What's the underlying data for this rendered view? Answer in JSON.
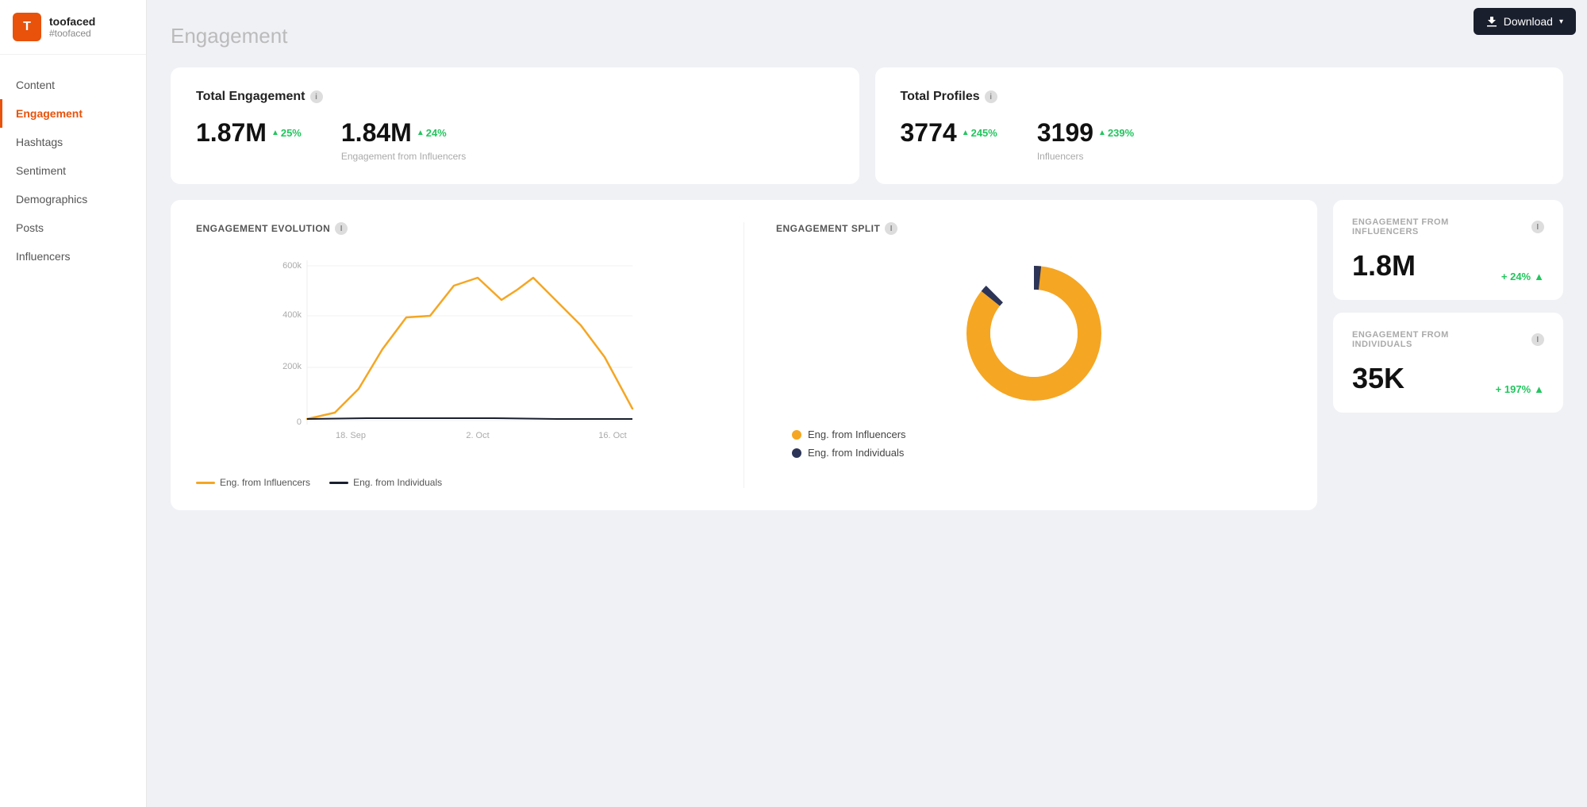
{
  "brand": {
    "avatar_letter": "T",
    "name": "toofaced",
    "handle": "#toofaced"
  },
  "nav": {
    "items": [
      {
        "label": "Content",
        "active": false,
        "id": "content"
      },
      {
        "label": "Engagement",
        "active": true,
        "id": "engagement"
      },
      {
        "label": "Hashtags",
        "active": false,
        "id": "hashtags"
      },
      {
        "label": "Sentiment",
        "active": false,
        "id": "sentiment"
      },
      {
        "label": "Demographics",
        "active": false,
        "id": "demographics"
      },
      {
        "label": "Posts",
        "active": false,
        "id": "posts"
      },
      {
        "label": "Influencers",
        "active": false,
        "id": "influencers"
      }
    ]
  },
  "page": {
    "title": "Engagement"
  },
  "download_button": "Download",
  "stats": {
    "total_engagement": {
      "title": "Total Engagement",
      "main_value": "1.87M",
      "main_change": "25%",
      "secondary_value": "1.84M",
      "secondary_change": "24%",
      "secondary_label": "Engagement from Influencers"
    },
    "total_profiles": {
      "title": "Total Profiles",
      "main_value": "3774",
      "main_change": "245%",
      "secondary_value": "3199",
      "secondary_change": "239%",
      "secondary_label": "Influencers"
    }
  },
  "engagement_evolution": {
    "title": "ENGAGEMENT EVOLUTION",
    "y_labels": [
      "600k",
      "400k",
      "200k",
      "0"
    ],
    "x_labels": [
      "18. Sep",
      "2. Oct",
      "16. Oct"
    ],
    "legend": [
      {
        "label": "Eng. from Influencers",
        "color": "#f5a623"
      },
      {
        "label": "Eng. from Individuals",
        "color": "#1a1f2e"
      }
    ]
  },
  "engagement_split": {
    "title": "ENGAGEMENT SPLIT",
    "legend": [
      {
        "label": "Eng. from Influencers",
        "color": "#f5a623"
      },
      {
        "label": "Eng. from Individuals",
        "color": "#2c3557"
      }
    ],
    "influencers_pct": 98,
    "individuals_pct": 2
  },
  "side_cards": [
    {
      "label": "ENGAGEMENT FROM\nINFLUENCERS",
      "value": "1.8M",
      "change": "+ 24%"
    },
    {
      "label": "ENGAGEMENT FROM\nINDIVIDUALS",
      "value": "35K",
      "change": "+ 197%"
    }
  ]
}
